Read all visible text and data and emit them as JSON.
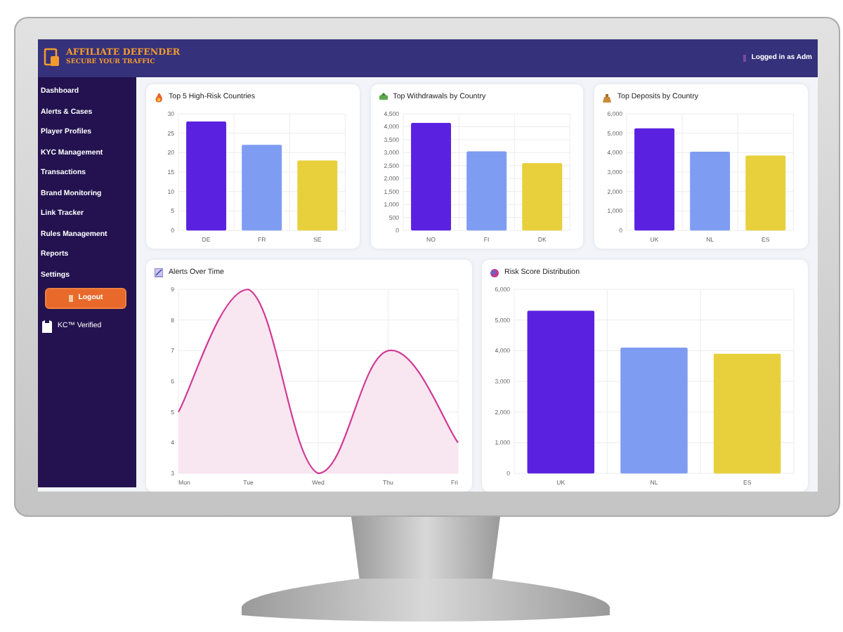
{
  "header": {
    "logo_title": "AFFILIATE DEFENDER",
    "logo_subtitle": "SECURE YOUR TRAFFIC",
    "user": "Logged in as Adm"
  },
  "sidebar": {
    "items": [
      "Dashboard",
      "Alerts & Cases",
      "Player Profiles",
      "KYC Management",
      "Transactions",
      "Brand Monitoring",
      "Link Tracker",
      "Rules Management",
      "Reports",
      "Settings"
    ],
    "logout": "Logout",
    "verified": "KC™ Verified"
  },
  "charts": [
    {
      "chart_data": {
        "type": "bar",
        "title": "Top 5 High-Risk Countries",
        "categories": [
          "DE",
          "FR",
          "SE"
        ],
        "grid": true,
        "series": [
          {
            "color": "#5a22e0",
            "values": [
              28,
              null,
              null
            ]
          },
          {
            "color": "#7e9cf2",
            "values": [
              null,
              22,
              null
            ]
          },
          {
            "color": "#e8d03c",
            "values": [
              null,
              null,
              18
            ]
          }
        ],
        "ylim": [
          0,
          30
        ],
        "yticks": [
          0,
          5,
          10,
          15,
          20,
          25,
          30
        ]
      }
    },
    {
      "chart_data": {
        "type": "bar",
        "title": "Top Withdrawals by Country",
        "categories": [
          "NO",
          "FI",
          "DK"
        ],
        "grid": true,
        "series": [
          {
            "color": "#5a22e0",
            "values": [
              4150,
              null,
              null
            ]
          },
          {
            "color": "#7e9cf2",
            "values": [
              null,
              3050,
              null
            ]
          },
          {
            "color": "#e8d03c",
            "values": [
              null,
              null,
              2600
            ]
          }
        ],
        "ylim": [
          0,
          4500
        ],
        "yticks": [
          0,
          {
            "value": 500,
            "label": "500"
          },
          {
            "value": 1000,
            "label": "1,000"
          },
          {
            "value": 1500,
            "label": "1,500"
          },
          {
            "value": 2000,
            "label": "2,000"
          },
          {
            "value": 2500,
            "label": "2,500"
          },
          {
            "value": 3000,
            "label": "3,000"
          },
          {
            "value": 3500,
            "label": "3,500"
          },
          {
            "value": 4000,
            "label": "4,000"
          },
          {
            "value": 4500,
            "label": "4,500"
          }
        ]
      }
    },
    {
      "chart_data": {
        "type": "bar",
        "title": "Top Deposits by Country",
        "categories": [
          "UK",
          "NL",
          "ES"
        ],
        "grid": true,
        "series": [
          {
            "color": "#5a22e0",
            "values": [
              5250,
              null,
              null
            ]
          },
          {
            "color": "#7e9cf2",
            "values": [
              null,
              4050,
              null
            ]
          },
          {
            "color": "#e8d03c",
            "values": [
              null,
              null,
              3850
            ]
          }
        ],
        "ylim": [
          0,
          6000
        ],
        "yticks": [
          0,
          {
            "value": 1000,
            "label": "1,000"
          },
          {
            "value": 2000,
            "label": "2,000"
          },
          {
            "value": 3000,
            "label": "3,000"
          },
          {
            "value": 4000,
            "label": "4,000"
          },
          {
            "value": 5000,
            "label": "5,000"
          },
          {
            "value": 6000,
            "label": "6,000"
          }
        ]
      }
    },
    {
      "chart_data": {
        "type": "area",
        "title": "Alerts Over Time",
        "x": [
          "Mon",
          "Tue",
          "Wed",
          "Thu",
          "Fri"
        ],
        "grid": true,
        "series": [
          {
            "color": "#d13a94",
            "values": [
              5,
              9,
              3,
              7,
              4
            ]
          }
        ],
        "ylim": [
          3,
          9
        ],
        "yticks": [
          3,
          4,
          5,
          6,
          7,
          8,
          9
        ]
      }
    },
    {
      "chart_data": {
        "type": "bar",
        "title": "Risk Score Distribution",
        "categories": [
          "UK",
          "NL",
          "ES"
        ],
        "grid": true,
        "series": [
          {
            "color": "#5a22e0",
            "values": [
              5300,
              null,
              null
            ]
          },
          {
            "color": "#7e9cf2",
            "values": [
              null,
              4100,
              null
            ]
          },
          {
            "color": "#e8d03c",
            "values": [
              null,
              null,
              3900
            ]
          }
        ],
        "ylim": [
          0,
          6000
        ],
        "yticks": [
          0,
          {
            "value": 1000,
            "label": "1,000"
          },
          {
            "value": 2000,
            "label": "2,000"
          },
          {
            "value": 3000,
            "label": "3,000"
          },
          {
            "value": 4000,
            "label": "4,000"
          },
          {
            "value": 5000,
            "label": "5,000"
          },
          {
            "value": 6000,
            "label": "6,000"
          }
        ]
      }
    }
  ]
}
